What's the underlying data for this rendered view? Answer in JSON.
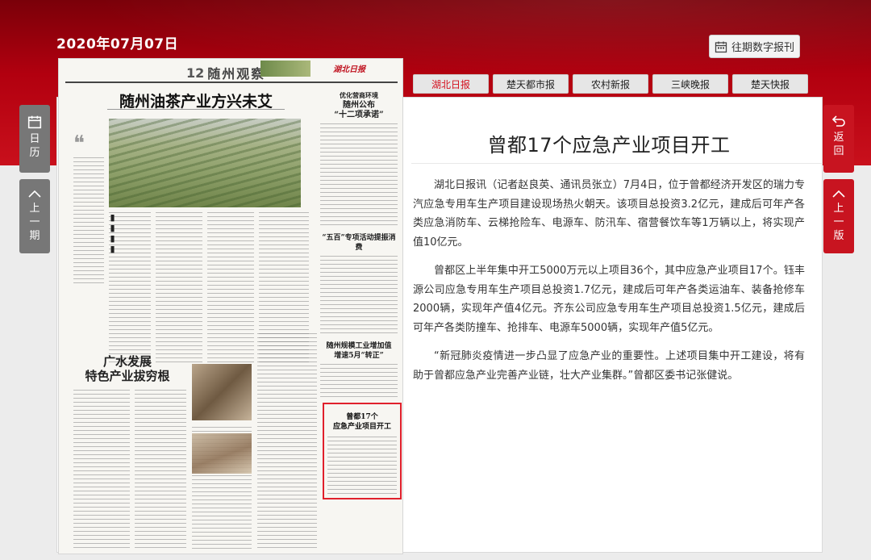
{
  "header": {
    "date": "2020年07月07日",
    "archive_label": "往期数字报刊"
  },
  "tabs": [
    {
      "label": "湖北日报",
      "active": true
    },
    {
      "label": "楚天都市报",
      "active": false
    },
    {
      "label": "农村新报",
      "active": false
    },
    {
      "label": "三峡晚报",
      "active": false
    },
    {
      "label": "楚天快报",
      "active": false
    }
  ],
  "left_nav": {
    "calendar": {
      "label": [
        "日",
        "历"
      ]
    },
    "prev_issue": {
      "label": [
        "上",
        "一",
        "期"
      ]
    }
  },
  "right_nav": {
    "back": {
      "label": [
        "返",
        "回"
      ]
    },
    "prev_page": {
      "label": [
        "上",
        "一",
        "版"
      ]
    }
  },
  "paper": {
    "page_number": "12",
    "page_name": "随州观察",
    "masthead": "湖北日报",
    "headline_main": "随州油茶产业方兴未艾",
    "side_top_kicker": "优化营商环境",
    "side_top_head": [
      "随州公布",
      "“十二项承诺”"
    ],
    "side_mid_head": "“五百”专项活动提振消费",
    "side_low_head": [
      "随州规模工业增加值",
      "增速5月“转正”"
    ],
    "headline_second": [
      "广水发展",
      "特色产业拔穷根"
    ],
    "highlight_head": [
      "曾都17个",
      "应急产业项目开工"
    ]
  },
  "article": {
    "title": "曾都17个应急产业项目开工",
    "paragraphs": [
      "湖北日报讯（记者赵良英、通讯员张立）7月4日，位于曾都经济开发区的瑞力专汽应急专用车生产项目建设现场热火朝天。该项目总投资3.2亿元，建成后可年产各类应急消防车、云梯抢险车、电源车、防汛车、宿营餐饮车等1万辆以上，将实现产值10亿元。",
      "曾都区上半年集中开工5000万元以上项目36个，其中应急产业项目17个。钰丰源公司应急专用车生产项目总投资1.7亿元，建成后可年产各类运油车、装备抢修车2000辆，实现年产值4亿元。齐东公司应急专用车生产项目总投资1.5亿元，建成后可年产各类防撞车、抢排车、电源车5000辆，实现年产值5亿元。",
      "“新冠肺炎疫情进一步凸显了应急产业的重要性。上述项目集中开工建设，将有助于曾都应急产业完善产业链，壮大产业集群。”曾都区委书记张健说。"
    ]
  },
  "colors": {
    "brand_red": "#c81420",
    "band_dark": "#7a0009",
    "active_tab_text": "#d40f1d"
  }
}
